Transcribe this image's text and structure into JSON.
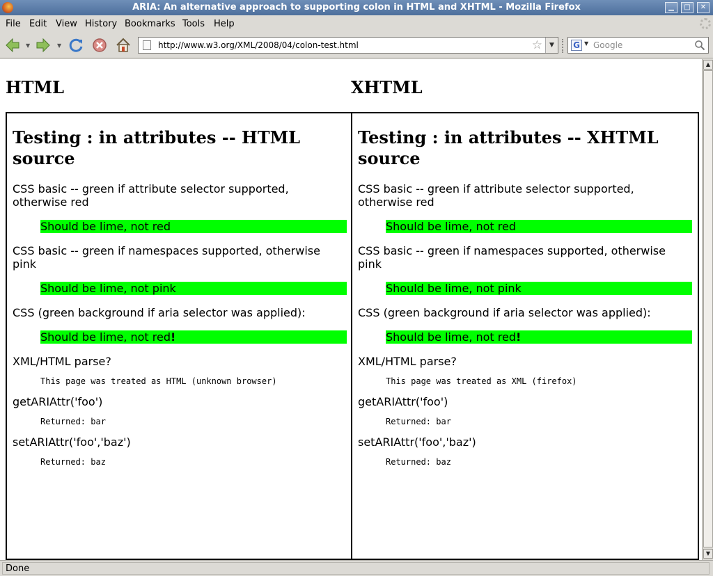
{
  "window": {
    "title": "ARIA: An alternative approach to supporting colon in HTML and XHTML - Mozilla Firefox",
    "controls": {
      "minimize": "▁",
      "maximize": "□",
      "close": "✕"
    }
  },
  "menu": {
    "items": [
      "File",
      "Edit",
      "View",
      "History",
      "Bookmarks",
      "Tools",
      "Help"
    ]
  },
  "navigation": {
    "url": "http://www.w3.org/XML/2008/04/colon-test.html",
    "search_placeholder": "Google"
  },
  "page": {
    "html_heading": "HTML",
    "xhtml_heading": "XHTML",
    "panels": [
      {
        "title": "Testing : in attributes -- HTML source",
        "css_basic_label": "CSS basic -- green if attribute selector supported, otherwise red",
        "css_basic_result": "Should be lime, not red",
        "css_ns_label": "CSS basic -- green if namespaces supported, otherwise pink",
        "css_ns_result": "Should be lime, not pink",
        "css_aria_label": "CSS (green background if aria selector was applied):",
        "css_aria_result": "Should be lime, not red",
        "css_aria_mark": "!",
        "parse_label": "XML/HTML parse?",
        "parse_result": "This page was treated as HTML (unknown browser)",
        "get_label": "getARIAttr('foo')",
        "get_result": "Returned: bar",
        "set_label": "setARIAttr('foo','baz')",
        "set_result": "Returned: baz"
      },
      {
        "title": "Testing : in attributes -- XHTML source",
        "css_basic_label": "CSS basic -- green if attribute selector supported, otherwise red",
        "css_basic_result": "Should be lime, not red",
        "css_ns_label": "CSS basic -- green if namespaces supported, otherwise pink",
        "css_ns_result": "Should be lime, not pink",
        "css_aria_label": "CSS (green background if aria selector was applied):",
        "css_aria_result": "Should be lime, not red",
        "css_aria_mark": "!",
        "parse_label": "XML/HTML parse?",
        "parse_result": "This page was treated as XML (firefox)",
        "get_label": "getARIAttr('foo')",
        "get_result": "Returned: bar",
        "set_label": "setARIAttr('foo','baz')",
        "set_result": "Returned: baz"
      }
    ]
  },
  "status": {
    "text": "Done"
  },
  "colors": {
    "lime": "#00ff00",
    "titlebar": "#5a7aa6"
  }
}
